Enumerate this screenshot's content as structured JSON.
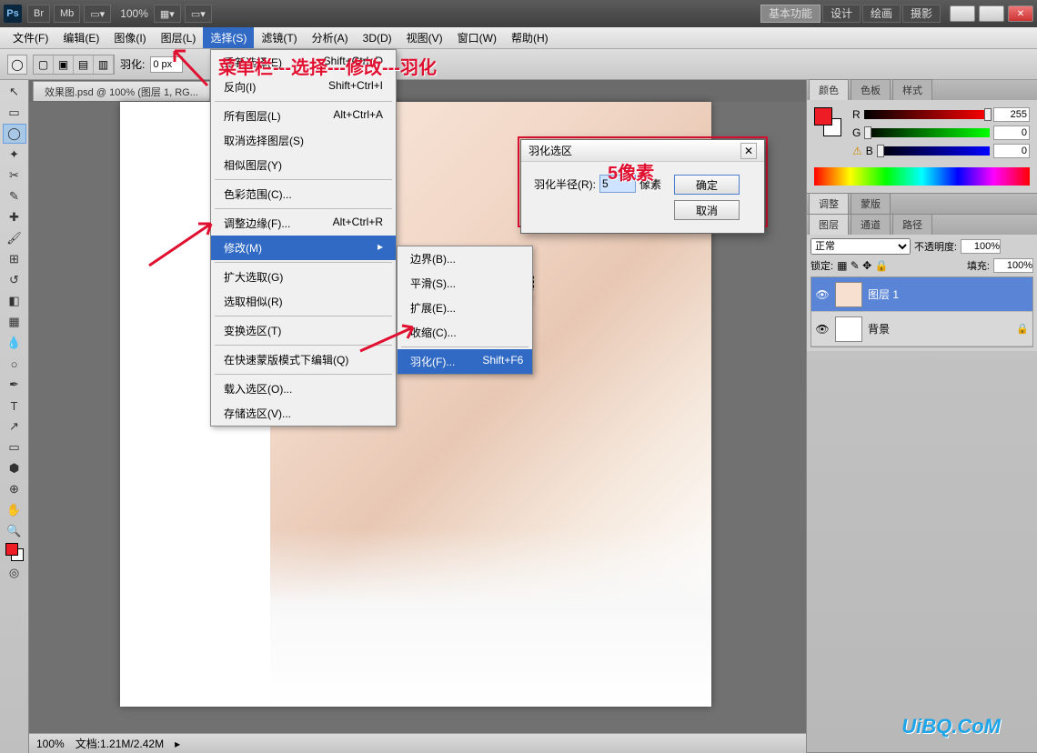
{
  "titlebar": {
    "ps": "Ps",
    "br": "Br",
    "mb": "Mb",
    "zoom": "100%",
    "ws": [
      "基本功能",
      "设计",
      "绘画",
      "摄影"
    ]
  },
  "menubar": {
    "items": [
      "文件(F)",
      "编辑(E)",
      "图像(I)",
      "图层(L)",
      "选择(S)",
      "滤镜(T)",
      "分析(A)",
      "3D(D)",
      "视图(V)",
      "窗口(W)",
      "帮助(H)"
    ]
  },
  "optionbar": {
    "feather_label": "羽化:",
    "feather_value": "0 px"
  },
  "doc": {
    "tab": "效果图.psd @ 100% (图层 1, RG...",
    "status_zoom": "100%",
    "status_doc": "文档:1.21M/2.42M"
  },
  "select_menu": {
    "items": [
      {
        "l": "重新选择(E)",
        "s": "Shift+Ctrl+D"
      },
      {
        "l": "反向(I)",
        "s": "Shift+Ctrl+I"
      },
      {
        "l": "所有图层(L)",
        "s": "Alt+Ctrl+A"
      },
      {
        "l": "取消选择图层(S)",
        "s": ""
      },
      {
        "l": "相似图层(Y)",
        "s": ""
      },
      {
        "l": "色彩范围(C)...",
        "s": ""
      },
      {
        "l": "调整边缘(F)...",
        "s": "Alt+Ctrl+R"
      },
      {
        "l": "修改(M)",
        "s": "",
        "sub": true
      },
      {
        "l": "扩大选取(G)",
        "s": ""
      },
      {
        "l": "选取相似(R)",
        "s": ""
      },
      {
        "l": "变换选区(T)",
        "s": ""
      },
      {
        "l": "在快速蒙版模式下编辑(Q)",
        "s": ""
      },
      {
        "l": "载入选区(O)...",
        "s": ""
      },
      {
        "l": "存储选区(V)...",
        "s": ""
      }
    ]
  },
  "modify_menu": {
    "items": [
      {
        "l": "边界(B)...",
        "s": ""
      },
      {
        "l": "平滑(S)...",
        "s": ""
      },
      {
        "l": "扩展(E)...",
        "s": ""
      },
      {
        "l": "收缩(C)...",
        "s": ""
      },
      {
        "l": "羽化(F)...",
        "s": "Shift+F6"
      }
    ]
  },
  "dialog": {
    "title": "羽化选区",
    "label": "羽化半径(R):",
    "value": "5",
    "unit": "像素",
    "ok": "确定",
    "cancel": "取消"
  },
  "panels": {
    "color": {
      "tabs": [
        "颜色",
        "色板",
        "样式"
      ],
      "r": "R",
      "g": "G",
      "b": "B",
      "rv": "255",
      "gv": "0",
      "bv": "0"
    },
    "adjust": {
      "tabs": [
        "调整",
        "蒙版"
      ]
    },
    "layers": {
      "tabs": [
        "图层",
        "通道",
        "路径"
      ],
      "mode": "正常",
      "opacity_l": "不透明度:",
      "opacity_v": "100%",
      "lock_l": "锁定:",
      "fill_l": "填充:",
      "fill_v": "100%",
      "rows": [
        {
          "name": "图层 1"
        },
        {
          "name": "背景"
        }
      ]
    }
  },
  "anno": {
    "path": "菜单栏---选择---修改---羽化",
    "px": "5像素"
  },
  "watermark": "UiBQ.CoM"
}
